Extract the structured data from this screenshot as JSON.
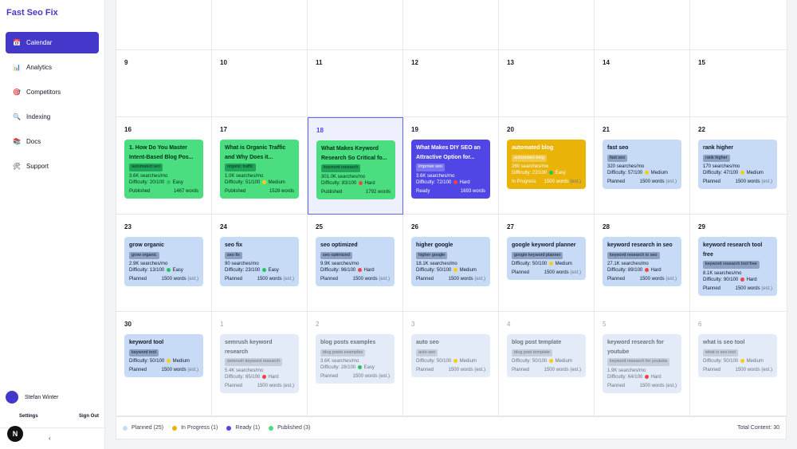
{
  "app": {
    "brand": "Fast Seo Fix"
  },
  "sidebar": {
    "items": [
      {
        "label": "Calendar",
        "icon": "calendar-icon",
        "glyph": "📅",
        "active": true
      },
      {
        "label": "Analytics",
        "icon": "analytics-icon",
        "glyph": "📊",
        "active": false
      },
      {
        "label": "Competitors",
        "icon": "target-icon",
        "glyph": "🎯",
        "active": false
      },
      {
        "label": "Indexing",
        "icon": "search-icon",
        "glyph": "🔍",
        "active": false
      },
      {
        "label": "Docs",
        "icon": "books-icon",
        "glyph": "📚",
        "active": false
      },
      {
        "label": "Support",
        "icon": "tools-icon",
        "glyph": "🛠",
        "active": false
      }
    ],
    "user_name": "Stefan Winter",
    "settings_label": "Settings",
    "signout_label": "Sign Out",
    "collapse_glyph": "‹",
    "badge_letter": "N"
  },
  "calendar": {
    "weeks": [
      [
        {
          "date": "",
          "other": false
        },
        {
          "date": "",
          "other": false
        },
        {
          "date": "",
          "other": false
        },
        {
          "date": "",
          "other": false
        },
        {
          "date": "",
          "other": false
        },
        {
          "date": "",
          "other": false
        },
        {
          "date": "",
          "other": false
        }
      ],
      [
        {
          "date": "9"
        },
        {
          "date": "10"
        },
        {
          "date": "11"
        },
        {
          "date": "12"
        },
        {
          "date": "13"
        },
        {
          "date": "14"
        },
        {
          "date": "15"
        }
      ],
      [
        {
          "date": "16",
          "card": {
            "status": "published",
            "title": "1. How Do You Master Intent-Based Blog Pos...",
            "tag": "automated seo",
            "searches": "3.6K searches/mo",
            "difficulty": "Difficulty: 20/100",
            "level": "Easy",
            "level_color": "#22c55e",
            "state": "Published",
            "words": "1467 words",
            "est": ""
          }
        },
        {
          "date": "17",
          "card": {
            "status": "published",
            "title": "What is Organic Traffic and Why Does it...",
            "tag": "organic traffic",
            "searches": "1.0K searches/mo",
            "difficulty": "Difficulty: 51/100",
            "level": "Medium",
            "level_color": "#facc15",
            "state": "Published",
            "words": "1528 words",
            "est": ""
          }
        },
        {
          "date": "18",
          "today": true,
          "card": {
            "status": "published",
            "title": "What Makes Keyword Research So Critical fo...",
            "tag": "keyword research",
            "searches": "301.0K searches/mo",
            "difficulty": "Difficulty: 83/100",
            "level": "Hard",
            "level_color": "#ef4444",
            "state": "Published",
            "words": "1792 words",
            "est": ""
          }
        },
        {
          "date": "19",
          "card": {
            "status": "ready",
            "title": "What Makes DIY SEO an Attractive Option for...",
            "tag": "improve seo",
            "searches": "3.6K searches/mo",
            "difficulty": "Difficulty: 72/100",
            "level": "Hard",
            "level_color": "#ef4444",
            "state": "Ready",
            "words": "1693 words",
            "est": ""
          }
        },
        {
          "date": "20",
          "card": {
            "status": "inprogress",
            "title": "automated blog",
            "tag": "automated blog",
            "searches": "260 searches/mo",
            "difficulty": "Difficulty: 22/100",
            "level": "Easy",
            "level_color": "#22c55e",
            "state": "In Progress",
            "words": "1500 words",
            "est": "(est.)"
          }
        },
        {
          "date": "21",
          "card": {
            "status": "planned",
            "title": "fast seo",
            "tag": "fast seo",
            "searches": "320 searches/mo",
            "difficulty": "Difficulty: 57/100",
            "level": "Medium",
            "level_color": "#facc15",
            "state": "Planned",
            "words": "1500 words",
            "est": "(est.)"
          }
        },
        {
          "date": "22",
          "card": {
            "status": "planned",
            "title": "rank higher",
            "tag": "rank higher",
            "searches": "170 searches/mo",
            "difficulty": "Difficulty: 47/100",
            "level": "Medium",
            "level_color": "#facc15",
            "state": "Planned",
            "words": "1500 words",
            "est": "(est.)"
          }
        }
      ],
      [
        {
          "date": "23",
          "card": {
            "status": "planned",
            "title": "grow organic",
            "tag": "grow organic",
            "searches": "2.9K searches/mo",
            "difficulty": "Difficulty: 13/100",
            "level": "Easy",
            "level_color": "#22c55e",
            "state": "Planned",
            "words": "1500 words",
            "est": "(est.)"
          }
        },
        {
          "date": "24",
          "card": {
            "status": "planned",
            "title": "seo fix",
            "tag": "seo fix",
            "searches": "90 searches/mo",
            "difficulty": "Difficulty: 23/100",
            "level": "Easy",
            "level_color": "#22c55e",
            "state": "Planned",
            "words": "1500 words",
            "est": "(est.)"
          }
        },
        {
          "date": "25",
          "card": {
            "status": "planned",
            "title": "seo optimized",
            "tag": "seo optimized",
            "searches": "9.9K searches/mo",
            "difficulty": "Difficulty: 96/100",
            "level": "Hard",
            "level_color": "#ef4444",
            "state": "Planned",
            "words": "1500 words",
            "est": "(est.)"
          }
        },
        {
          "date": "26",
          "card": {
            "status": "planned",
            "title": "higher google",
            "tag": "higher google",
            "searches": "18.1K searches/mo",
            "difficulty": "Difficulty: 50/100",
            "level": "Medium",
            "level_color": "#facc15",
            "state": "Planned",
            "words": "1500 words",
            "est": "(est.)"
          }
        },
        {
          "date": "27",
          "card": {
            "status": "planned",
            "title": "google keyword planner",
            "tag": "google keyword planner",
            "searches": "",
            "difficulty": "Difficulty: 50/100",
            "level": "Medium",
            "level_color": "#facc15",
            "state": "Planned",
            "words": "1500 words",
            "est": "(est.)"
          }
        },
        {
          "date": "28",
          "card": {
            "status": "planned",
            "title": "keyword research in seo",
            "tag": "keyword research in seo",
            "searches": "27.1K searches/mo",
            "difficulty": "Difficulty: 89/100",
            "level": "Hard",
            "level_color": "#ef4444",
            "state": "Planned",
            "words": "1500 words",
            "est": "(est.)"
          }
        },
        {
          "date": "29",
          "card": {
            "status": "planned",
            "title": "keyword research tool free",
            "tag": "keyword research tool free",
            "searches": "8.1K searches/mo",
            "difficulty": "Difficulty: 90/100",
            "level": "Hard",
            "level_color": "#ef4444",
            "state": "Planned",
            "words": "1500 words",
            "est": "(est.)"
          }
        }
      ],
      [
        {
          "date": "30",
          "card": {
            "status": "planned",
            "title": "keyword tool",
            "tag": "keyword tool",
            "searches": "",
            "difficulty": "Difficulty: 50/100",
            "level": "Medium",
            "level_color": "#facc15",
            "state": "Planned",
            "words": "1500 words",
            "est": "(est.)"
          }
        },
        {
          "date": "1",
          "other": true,
          "card": {
            "status": "faded",
            "title": "semrush keyword research",
            "tag": "semrush keyword research",
            "searches": "5.4K searches/mo",
            "difficulty": "Difficulty: 65/100",
            "level": "Hard",
            "level_color": "#ef4444",
            "state": "Planned",
            "words": "1500 words",
            "est": "(est.)"
          }
        },
        {
          "date": "2",
          "other": true,
          "card": {
            "status": "faded",
            "title": "blog posts examples",
            "tag": "blog posts examples",
            "searches": "3.6K searches/mo",
            "difficulty": "Difficulty: 28/100",
            "level": "Easy",
            "level_color": "#22c55e",
            "state": "Planned",
            "words": "1500 words",
            "est": "(est.)"
          }
        },
        {
          "date": "3",
          "other": true,
          "card": {
            "status": "faded",
            "title": "auto seo",
            "tag": "auto seo",
            "searches": "",
            "difficulty": "Difficulty: 50/100",
            "level": "Medium",
            "level_color": "#facc15",
            "state": "Planned",
            "words": "1500 words",
            "est": "(est.)"
          }
        },
        {
          "date": "4",
          "other": true,
          "card": {
            "status": "faded",
            "title": "blog post template",
            "tag": "blog post template",
            "searches": "",
            "difficulty": "Difficulty: 50/100",
            "level": "Medium",
            "level_color": "#facc15",
            "state": "Planned",
            "words": "1500 words",
            "est": "(est.)"
          }
        },
        {
          "date": "5",
          "other": true,
          "card": {
            "status": "faded",
            "title": "keyword research for youtube",
            "tag": "keyword research for youtube",
            "searches": "1.9K searches/mo",
            "difficulty": "Difficulty: 64/100",
            "level": "Hard",
            "level_color": "#ef4444",
            "state": "Planned",
            "words": "1500 words",
            "est": "(est.)"
          }
        },
        {
          "date": "6",
          "other": true,
          "card": {
            "status": "faded",
            "title": "what is seo tool",
            "tag": "what is seo tool",
            "searches": "",
            "difficulty": "Difficulty: 50/100",
            "level": "Medium",
            "level_color": "#facc15",
            "state": "Planned",
            "words": "1500 words",
            "est": "(est.)"
          }
        }
      ]
    ]
  },
  "legend": {
    "items": [
      {
        "label": "Planned (25)",
        "color": "#c7dbf7"
      },
      {
        "label": "In Progress (1)",
        "color": "#eab308"
      },
      {
        "label": "Ready (1)",
        "color": "#4f46e5"
      },
      {
        "label": "Published (3)",
        "color": "#4ade80"
      }
    ],
    "total": "Total Content: 30"
  }
}
